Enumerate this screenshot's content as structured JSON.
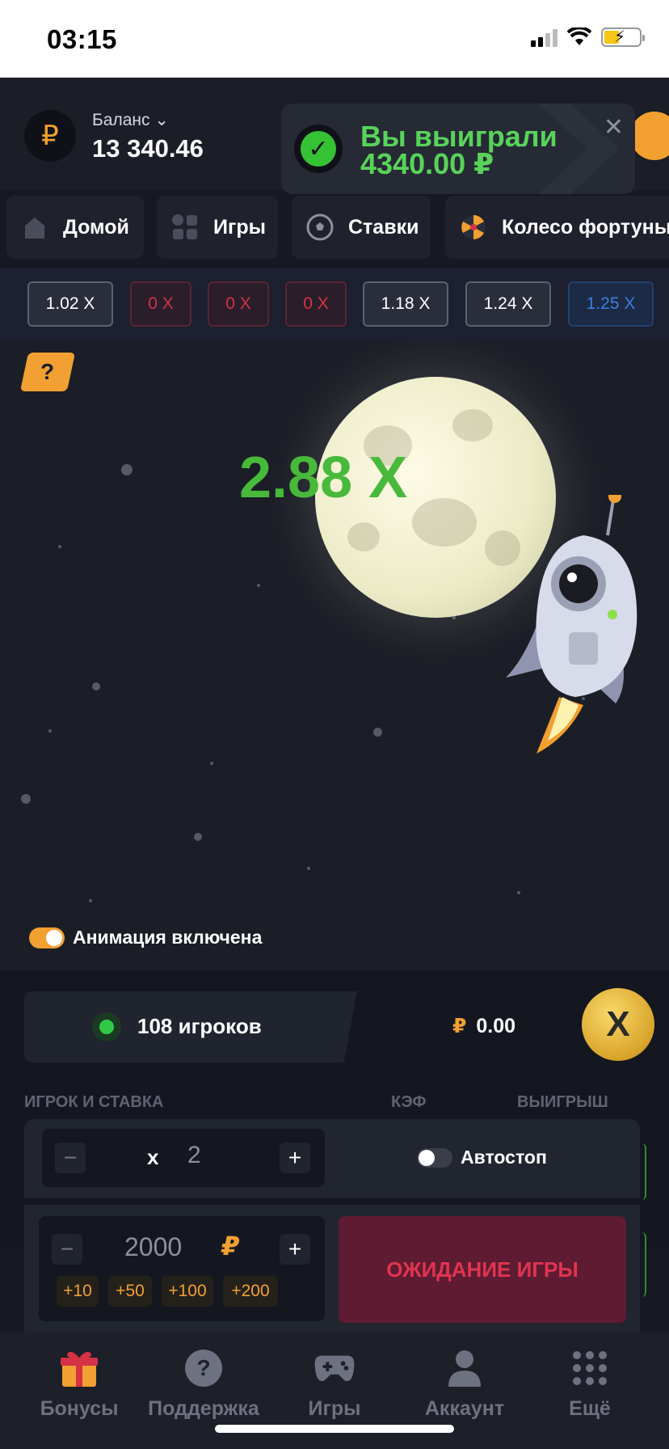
{
  "status": {
    "time": "03:15"
  },
  "header": {
    "currency_symbol": "₽",
    "balance_label": "Баланс",
    "balance_value": "13 340.46"
  },
  "toast": {
    "line1": "Вы выиграли",
    "line2": "4340.00 ₽"
  },
  "nav": [
    {
      "label": "Домой",
      "icon": "home-icon"
    },
    {
      "label": "Игры",
      "icon": "grid-icon"
    },
    {
      "label": "Ставки",
      "icon": "soccer-ball-icon"
    },
    {
      "label": "Колесо фортуны",
      "icon": "wheel-icon"
    }
  ],
  "multipliers": [
    {
      "label": "1.02 X",
      "status": "normal"
    },
    {
      "label": "0 X",
      "status": "crash"
    },
    {
      "label": "0 X",
      "status": "crash"
    },
    {
      "label": "0 X",
      "status": "crash"
    },
    {
      "label": "1.18 X",
      "status": "normal"
    },
    {
      "label": "1.24 X",
      "status": "normal"
    },
    {
      "label": "1.25 X",
      "status": "high"
    }
  ],
  "game": {
    "help_label": "?",
    "current_multiplier": "2.88 X",
    "animation_label": "Анимация включена",
    "animation_on": true
  },
  "stats": {
    "players": "108 игроков",
    "pot_currency": "₽",
    "pot_value": "0.00",
    "coin_letter": "X"
  },
  "columns": {
    "player_bet": "ИГРОК И СТАВКА",
    "coef": "КЭФ",
    "win": "ВЫИГРЫШ"
  },
  "bet": {
    "minus": "−",
    "plus": "+",
    "x_label": "x",
    "multiplier_value": "2",
    "autostop_label": "Автостоп",
    "autostop_on": false,
    "amount": "2000",
    "currency": "₽",
    "quick": [
      "+10",
      "+50",
      "+100",
      "+200"
    ],
    "wait_button": "ОЖИДАНИЕ ИГРЫ"
  },
  "tabbar": [
    {
      "label": "Бонусы",
      "icon": "gift-icon"
    },
    {
      "label": "Поддержка",
      "icon": "help-circle-icon"
    },
    {
      "label": "Игры",
      "icon": "gamepad-icon"
    },
    {
      "label": "Аккаунт",
      "icon": "user-icon"
    },
    {
      "label": "Ещё",
      "icon": "dots-grid-icon"
    }
  ],
  "colors": {
    "accent": "#f2a031",
    "win_green": "#47b93b",
    "crash_red": "#d53245",
    "high_blue": "#3d7de0"
  }
}
